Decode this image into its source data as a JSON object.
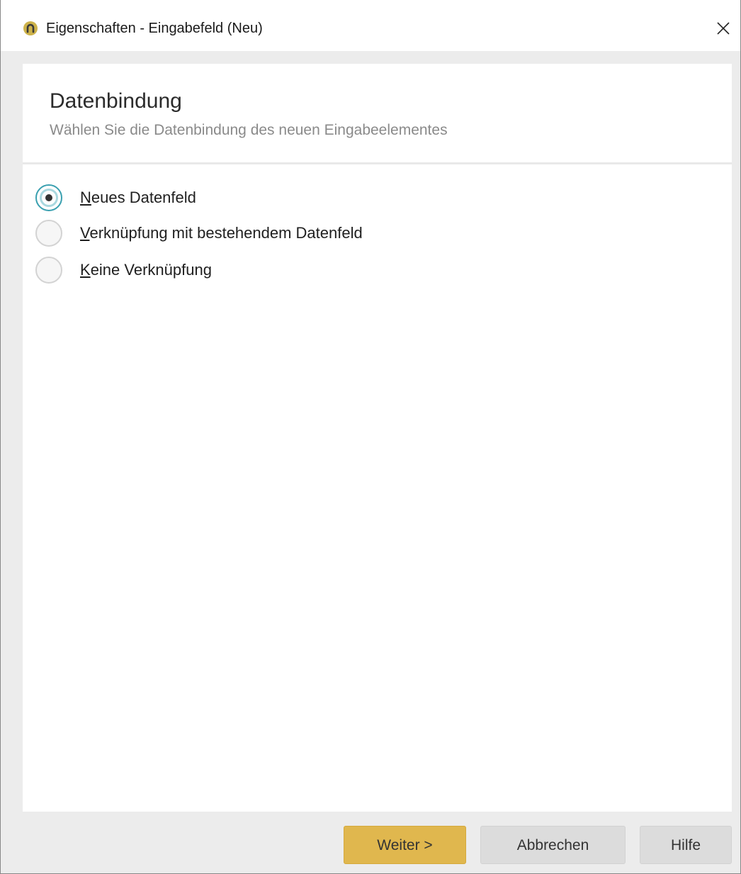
{
  "window": {
    "title": "Eigenschaften - Eingabefeld (Neu)",
    "app_icon": "app-logo-icon",
    "close_icon": "close-icon"
  },
  "header": {
    "title": "Datenbindung",
    "subtitle": "Wählen Sie die Datenbindung des neuen Eingabeelementes"
  },
  "options": [
    {
      "accel": "N",
      "rest": "eues Datenfeld",
      "checked": true
    },
    {
      "accel": "V",
      "rest": "erknüpfung mit bestehendem Datenfeld",
      "checked": false
    },
    {
      "accel": "K",
      "rest": "eine Verknüpfung",
      "checked": false
    }
  ],
  "buttons": {
    "next": "Weiter >",
    "cancel": "Abbrechen",
    "help": "Hilfe"
  },
  "colors": {
    "accent": "#e0b74e",
    "radio_selected": "#3aa0b0",
    "app_icon": "#cdb24a"
  }
}
